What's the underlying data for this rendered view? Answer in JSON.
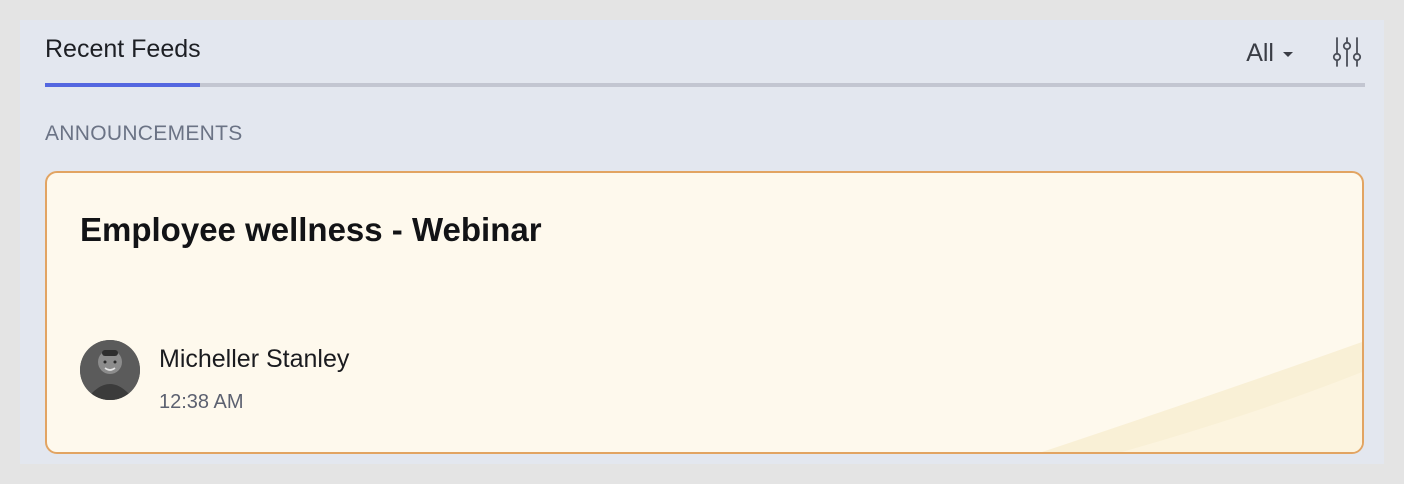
{
  "header": {
    "active_tab": "Recent Feeds",
    "filter": {
      "selected": "All"
    },
    "settings_icon": "sliders-icon"
  },
  "section": {
    "heading": "ANNOUNCEMENTS"
  },
  "announcement": {
    "title": "Employee wellness - Webinar",
    "author": "Micheller Stanley",
    "time": "12:38 AM",
    "avatar_icon": "user-avatar"
  },
  "colors": {
    "accent": "#5467e0",
    "card_background": "#fef9ed",
    "card_border": "#e2a462",
    "panel_background": "#e3e7ef"
  }
}
